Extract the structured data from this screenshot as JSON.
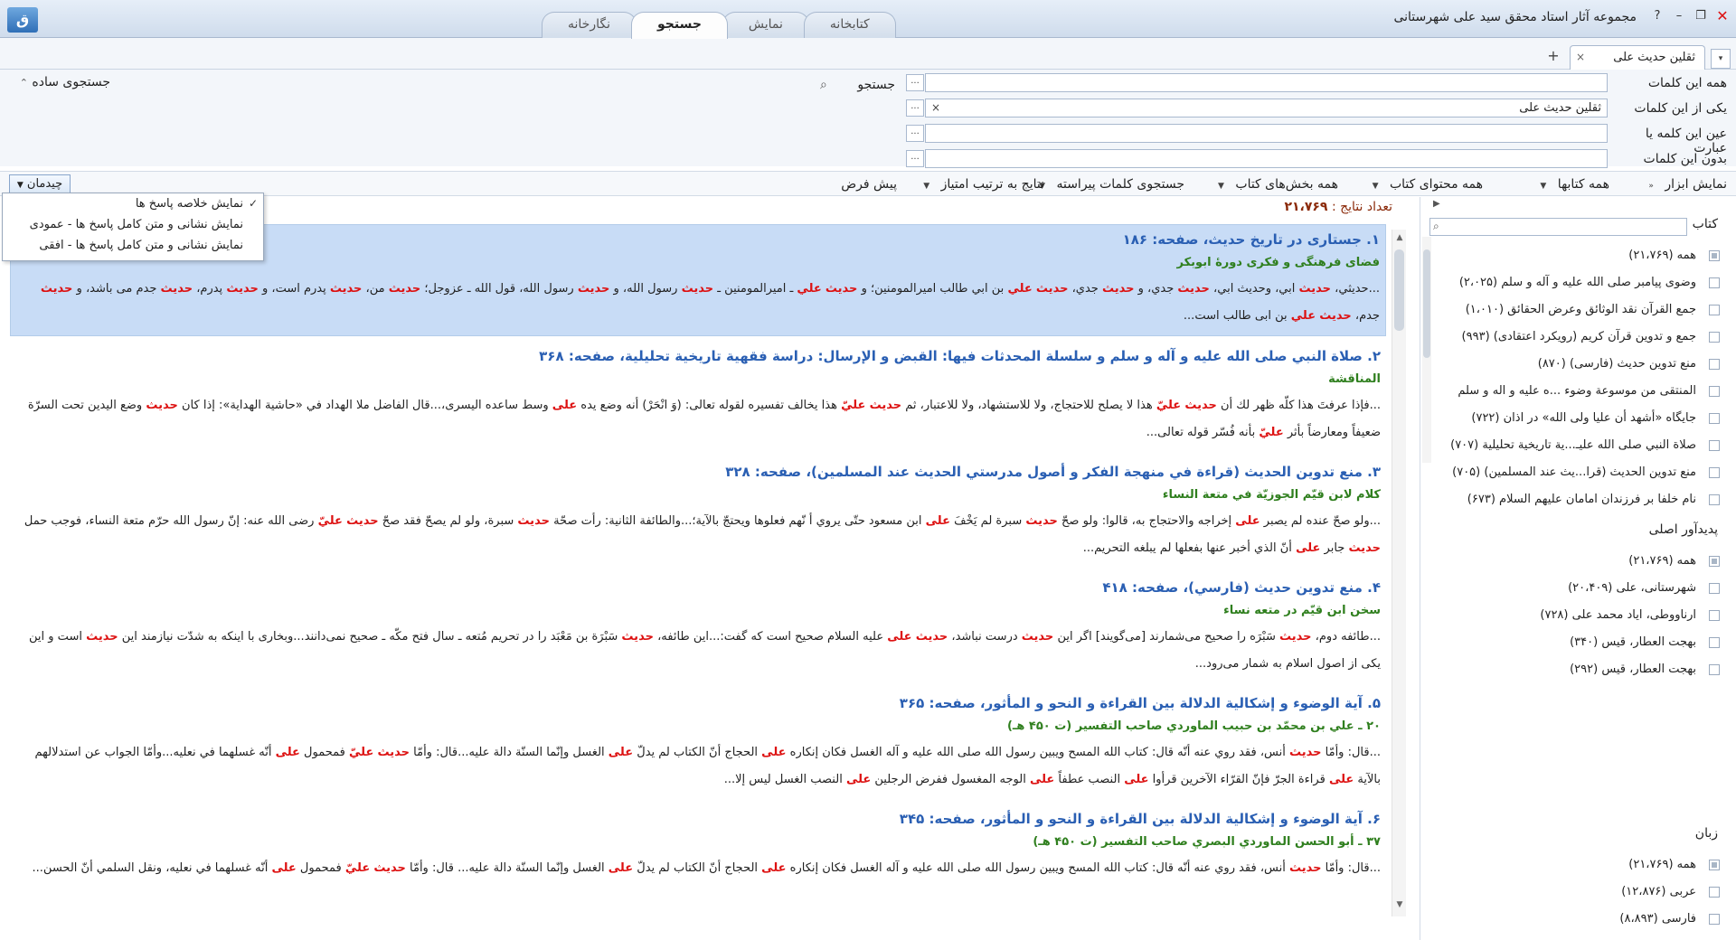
{
  "window": {
    "title": "مجموعه آثار استاد محقق سید علی شهرستانی",
    "logo": "app-logo-icon",
    "controls": [
      "?",
      "–",
      "❐",
      "✕"
    ]
  },
  "main_tabs": [
    "کتابخانه",
    "نمایش",
    "جستجو",
    "نگارخانه"
  ],
  "active_tab": "جستجو",
  "doc_tab": {
    "label": "ثقلین حدیث علی",
    "close": "×",
    "add": "+",
    "menu": "▾"
  },
  "search": {
    "fields": [
      {
        "label": "همه این کلمات",
        "value": ""
      },
      {
        "label": "یکی از این کلمات",
        "value": "ثقلین حدیث علی"
      },
      {
        "label": "عین این کلمه یا عبارت",
        "value": ""
      },
      {
        "label": "بدون این کلمات",
        "value": ""
      }
    ],
    "more": "...",
    "clear": "×",
    "button": "جستجو",
    "simple_search": "جستجوی ساده"
  },
  "toolbar": {
    "show_tools": "نمایش ابزار",
    "all_books": "همه کتابها",
    "all_content": "همه محتوای کتاب",
    "all_sections": "همه بخش‌های کتاب",
    "word_search": "جستجوی کلمات پیراسته",
    "sort": "نتایج به ترتیب امتیاز",
    "default": "پیش فرض",
    "arrange": "چیدمان"
  },
  "arrange_menu": [
    {
      "label": "نمایش خلاصه پاسخ ها",
      "checked": true
    },
    {
      "label": "نمایش نشانی و متن کامل پاسخ ها - عمودی",
      "checked": false
    },
    {
      "label": "نمایش نشانی و متن کامل پاسخ ها - افقی",
      "checked": false
    }
  ],
  "results": {
    "count_label": "تعداد نتایج :",
    "count": "۲۱،۷۶۹",
    "items": [
      {
        "title": "۱. جستاری در تاریخ حدیث، صفحه: ۱۸۶",
        "subtitle": "فضای فرهنگی و فکری دورهٔ ابوبکر",
        "text": "...حديثي، حديث ابي، وحديث ابي، حديث جدي، و حديث جدي، حديث علي بن ابي طالب اميرالمومنين؛ و حديث علي ـ اميرالمومنين ـ حديث رسول الله، و حديث رسول الله، قول الله ـ عزوجل؛ حديث من، حديث پدرم است، و حديث پدرم، حديث جدم می باشد، و حديث جدم، حديث علي بن ابی طالب است..."
      },
      {
        "title": "۲. صلاة النبي صلی الله عليه و آله و سلم و سلسلة المحدثات فيها: القبض و الإرسال: دراسة فقهية تاريخية تحليلية، صفحه: ۳۶۸",
        "subtitle": "المناقشة",
        "text": "...فإذا عرفتَ هذا كلّه ظهر لك أن حديث عليّ هذا لا يصلح للاحتجاج، ولا للاستشهاد، ولا للاعتبار، ثم حديث عليّ هذا يخالف تفسيره لقوله تعالى: (وَ انْحَرْ) أنه وضع يده على وسط ساعده اليسرى،...قال الفاضل ملا الهداد في «حاشية الهداية»: إذا كان حديث وضع اليدين تحت السرّة ضعيفاً ومعارضاً بأثر عليّ بأنه فُسّر قوله تعالى..."
      },
      {
        "title": "۳. منع تدوين الحديث (قراءة في منهجة الفكر و أصول مدرستي الحديث عند المسلمين)، صفحه: ۳۲۸",
        "subtitle": "كلام لابن قيّم الجوزيّة في متعة النساء",
        "text": "...ولو صحّ عنده لم يصبر على إخراجه والاحتجاج به، قالوا: ولو صحّ حديث سبرة لم يَخْفَ على ابن مسعود حتّى يروي أ نّهم فعلوها ويحتجّ بالآية؛...والطائفة الثانية: رأت صحّة حديث سبرة، ولو لم يصحّ فقد صحّ حديث عليّ رضی الله عنه: إنّ رسول الله حرّم متعة النساء، فوجب حمل حديث جابر على أنّ الذي أخبر عنها بفعلها لم يبلغه التحريم..."
      },
      {
        "title": "۴. منع تدوين حديث (فارسي)، صفحه: ۴۱۸",
        "subtitle": "سخن ابن قيّم در متعه نساء",
        "text": "...طائفه دوم، حديث سَبْرَه را صحيح می‌شمارند [می‌گويند] اگر اين حديث درست نباشد، حديث علی عليه السلام صحيح است كه گفت:...اين طائفه، حديث سَبْرَة بن مَعْبَد را در تحريم مُتعه ـ سال فتح مكّه ـ صحيح نمی‌دانند...وبخاری با اينكه به شدّت نيازمند اين حديث است و اين يكی از اصول اسلام به شمار می‌رود..."
      },
      {
        "title": "۵. آية الوضوء و إشكالية الدلالة بين القراءة و النحو و المأثور، صفحه: ۳۶۵",
        "subtitle": "۲۰ ـ علي بن محمّد بن حبيب الماوردي صاحب التفسير (ت ۴۵۰ هـ)",
        "text": "...قال: وأمّا حديث أنس، فقد روي عنه أنّه قال: كتاب الله المسح ويبين رسول الله صلی الله عليه و آله الغسل فكان إنكاره على الحجاج أنّ الكتاب لم يدلّ على الغسل وإنّما السنّة دالة عليه...قال: وأمّا حديث عليّ فمحمول على أنّه غسلهما في نعليه...وأمّا الجواب عن استدلالهم بالآية على قراءة الجرّ فإنّ القرّاء الآخرين قرأوا على النصب عطفاً على الوجه المغسول ففرض الرجلين على النصب الغسل ليس إلا..."
      },
      {
        "title": "۶. آية الوضوء و إشكالية الدلالة بين القراءة و النحو و المأثور، صفحه: ۳۴۵",
        "subtitle": "۳۷ ـ أبو الحسن الماوردي البصري صاحب التفسير (ت ۴۵۰ هـ)",
        "text": "...قال: وأمّا حديث أنس، فقد روي عنه أنّه قال: كتاب الله المسح ويبين رسول الله صلی الله عليه و آله الغسل فكان إنكاره على الحجاج أنّ الكتاب لم يدلّ على الغسل وإنّما السنّة دالة عليه... قال: وأمّا حديث عليّ فمحمول على أنّه غسلهما في نعليه، ونقل السلمي أنّ الحسن..."
      }
    ]
  },
  "facets": {
    "books": {
      "title": "کتاب",
      "items": [
        "همه (۲۱،۷۶۹)",
        "وضوی پیامبر صلی الله علیه و آله و سلم (۲،۰۲۵)",
        "جمع القرآن نقد الوثائق وعرض الحقائق (۱،۰۱۰)",
        "جمع و تدوین قرآن کریم (رویکرد اعتقادی) (۹۹۳)",
        "منع تدوین حدیث (فارسی) (۸۷۰)",
        "المنتقی من موسوعة وضوء ...ه علیه و اله و سلم",
        "جایگاه «أشهد أن علیا ولی الله» در اذان (۷۲۲)",
        "صلاة النبي صلی الله عليـ...ية تاريخية تحليلية (۷۰۷)",
        "منع تدوين الحديث (قرا...يث عند المسلمين) (۷۰۵)",
        "نام خلفا بر فرزندان امامان علیهم السلام (۶۷۳)"
      ]
    },
    "authors": {
      "title": "پدیدآور اصلی",
      "items": [
        "همه (۲۱،۷۶۹)",
        "شهرستانی، علی (۲۰،۴۰۹)",
        "ارناووطی، ایاد محمد علی (۷۲۸)",
        "بهجت العطار، قیس (۳۴۰)",
        "بهجت العطار، قیس (۲۹۲)"
      ]
    },
    "languages": {
      "title": "زبان",
      "items": [
        "همه (۲۱،۷۶۹)",
        "عربی (۱۲،۸۷۶)",
        "فارسی (۸،۸۹۳)"
      ]
    }
  }
}
